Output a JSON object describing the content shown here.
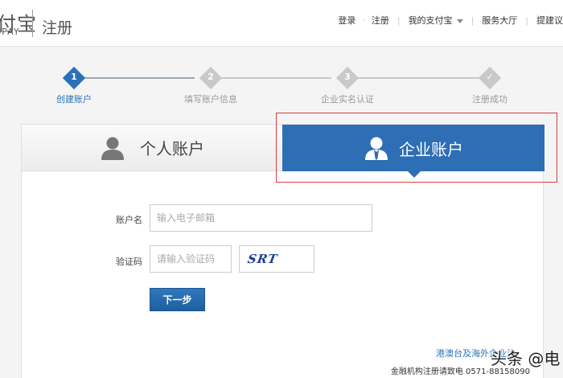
{
  "header": {
    "logo_text": "付宝",
    "logo_sub": "IPAY",
    "title": "注册",
    "nav": {
      "login": "登录",
      "register": "注册",
      "my_alipay": "我的支付宝",
      "service": "服务大厅",
      "suggest": "提建议"
    }
  },
  "steps": [
    {
      "num": "1",
      "label": "创建账户"
    },
    {
      "num": "2",
      "label": "填写账户信息"
    },
    {
      "num": "3",
      "label": "企业实名认证"
    },
    {
      "num": "✓",
      "label": "注册成功"
    }
  ],
  "tabs": {
    "personal": "个人账户",
    "enterprise": "企业账户"
  },
  "form": {
    "account_label": "账户名",
    "account_placeholder": "输入电子邮箱",
    "captcha_label": "验证码",
    "captcha_placeholder": "请输入验证码",
    "captcha_image_text": "SRT",
    "next_button": "下一步"
  },
  "footer": {
    "hk_link": "港澳台及海外企业注",
    "finance_note": "金融机构注册请致电 0571-88158090"
  },
  "watermark": "头条 @电",
  "colors": {
    "accent": "#2a72b8",
    "tab_active": "#2d6eb4",
    "highlight": "#e0393c"
  }
}
